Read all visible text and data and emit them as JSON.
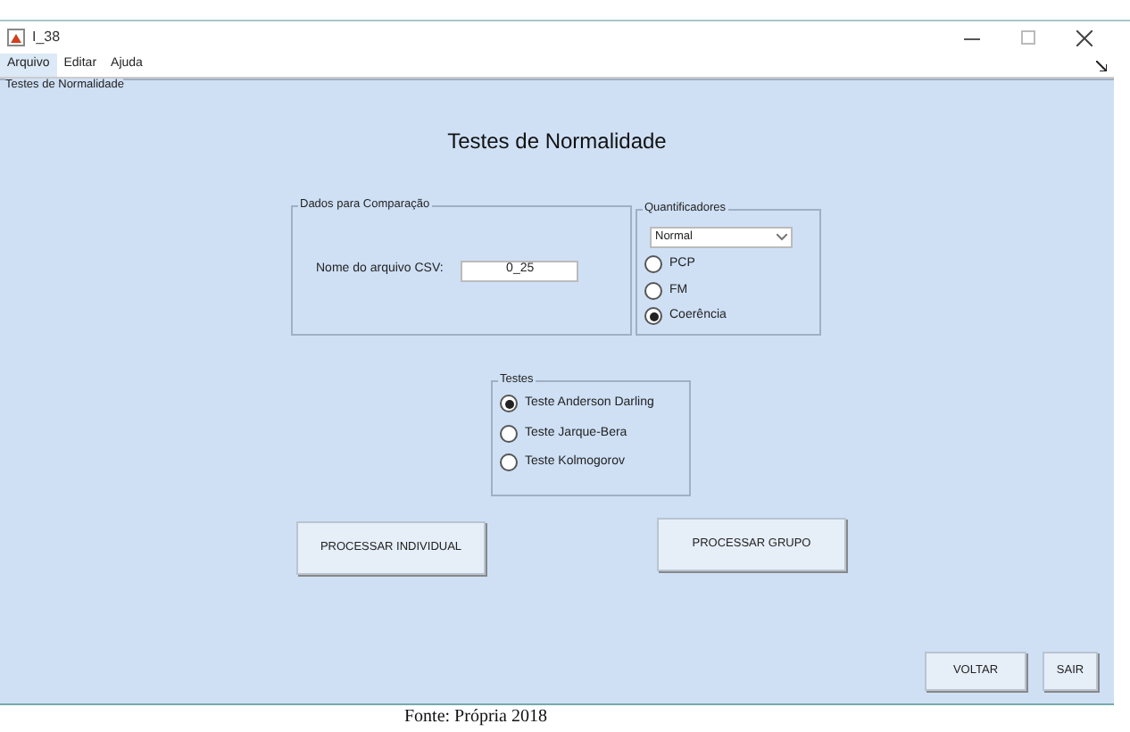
{
  "window": {
    "title": "I_38"
  },
  "menu": [
    {
      "label": "Arquivo",
      "selected": true
    },
    {
      "label": "Editar",
      "selected": false
    },
    {
      "label": "Ajuda",
      "selected": false
    }
  ],
  "panel": {
    "title": "Testes de Normalidade",
    "heading": "Testes de Normalidade"
  },
  "comparison": {
    "title": "Dados para Comparação",
    "field_label": "Nome do arquivo CSV:",
    "value": "0_25"
  },
  "quantifiers": {
    "title": "Quantificadores",
    "dropdown": "Normal",
    "options": [
      {
        "label": "PCP",
        "selected": false
      },
      {
        "label": "FM",
        "selected": false
      },
      {
        "label": "Coerência",
        "selected": true
      }
    ]
  },
  "tests": {
    "title": "Testes",
    "options": [
      {
        "label": "Teste Anderson Darling",
        "selected": true
      },
      {
        "label": "Teste Jarque-Bera",
        "selected": false
      },
      {
        "label": "Teste Kolmogorov",
        "selected": false
      }
    ]
  },
  "process_buttons": [
    "PROCESSAR INDIVIDUAL",
    "PROCESSAR GRUPO"
  ],
  "footer_buttons": [
    "VOLTAR",
    "SAIR"
  ],
  "caption": "Fonte: Própria 2018"
}
